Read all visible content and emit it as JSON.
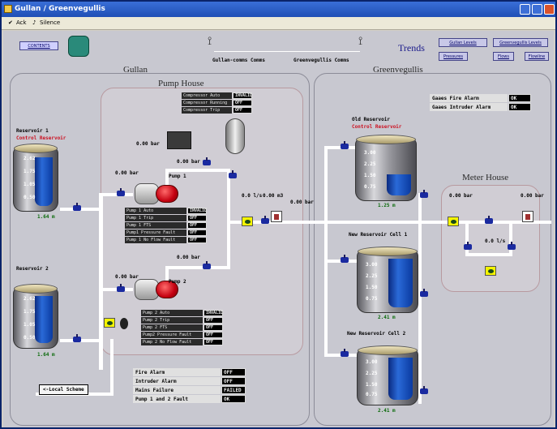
{
  "window": {
    "title": "Gullan / Greenvegullis"
  },
  "menu": {
    "item1": "Ack",
    "item2": "Silence"
  },
  "toolbar": {
    "contents_label": "CONTENTS"
  },
  "comms": {
    "label1": "Gullan-comms Comms",
    "label2": "Greenvegullis Comms"
  },
  "trends": {
    "label": "Trends",
    "buttons": [
      "Gullan Levels",
      "Greenvegullis Levels",
      "Pressures",
      "Flows",
      "Flowline"
    ]
  },
  "areas": {
    "gullan": "Gullan",
    "pump_house": "Pump House",
    "greenvegullis": "Greenvegullis",
    "meter_house": "Meter House"
  },
  "compressor": {
    "rows": [
      {
        "k": "Compressor Auto",
        "v": "INVALID"
      },
      {
        "k": "Compressor Running",
        "v": "OFF"
      },
      {
        "k": "Compressor Trip",
        "v": "OFF"
      }
    ]
  },
  "gv_alarms": {
    "rows": [
      {
        "k": "Gaaes Fire Alarm",
        "v": "OK"
      },
      {
        "k": "Gaaes Intruder Alarm",
        "v": "OK"
      }
    ]
  },
  "reservoirs": {
    "r1": {
      "label": "Reservoir 1",
      "sub": "Control Reservoir",
      "level": "1.64 m",
      "scale": [
        "2.62",
        "1.75",
        "1.05",
        "0.50"
      ]
    },
    "r2": {
      "label": "Reservoir 2",
      "level": "1.64 m",
      "scale": [
        "2.62",
        "1.75",
        "1.05",
        "0.50"
      ]
    },
    "old": {
      "label": "Old Reservoir",
      "sub": "Control Reservoir",
      "level": "1.25 m",
      "scale": [
        "3.00",
        "2.25",
        "1.50",
        "0.75"
      ]
    },
    "new1": {
      "label": "New Reservoir Cell 1",
      "level": "2.41 m",
      "scale": [
        "3.00",
        "2.25",
        "1.50",
        "0.75"
      ]
    },
    "new2": {
      "label": "New Reservoir Cell 2",
      "level": "2.41 m",
      "scale": [
        "3.00",
        "2.25",
        "1.50",
        "0.75"
      ]
    }
  },
  "pump1": {
    "label": "Pump 1",
    "rows": [
      {
        "k": "Pump 1 Auto",
        "v": "INVALID"
      },
      {
        "k": "Pump 1 Trip",
        "v": "OFF"
      },
      {
        "k": "Pump 1 FTS",
        "v": "OFF"
      },
      {
        "k": "Pump1 Pressure Fault",
        "v": "OFF"
      },
      {
        "k": "Pump 1 No Flow Fault",
        "v": "OFF"
      }
    ]
  },
  "pump2": {
    "label": "Pump 2",
    "rows": [
      {
        "k": "Pump 2 Auto",
        "v": "INVALID"
      },
      {
        "k": "Pump 2 Trip",
        "v": "OFF"
      },
      {
        "k": "Pump 2 FTS",
        "v": "OFF"
      },
      {
        "k": "Pump2 Pressure Fault",
        "v": "OFF"
      },
      {
        "k": "Pump 2 No Flow Fault",
        "v": "OFF"
      }
    ]
  },
  "readings": {
    "p1_top": "0.00 bar",
    "p1_in": "0.00 bar",
    "p2_top": "0.00 bar",
    "p2_in": "0.00 bar",
    "comp": "0.00 bar",
    "flow": "0.0 l/s",
    "flow2": "0.00 m3",
    "line": "0.00 bar",
    "mh_in": "0.00 bar",
    "mh_out": "0.00 bar",
    "mh_flow": "0.0 l/s"
  },
  "site_alarms": {
    "rows": [
      {
        "k": "Fire Alarm",
        "v": "OFF"
      },
      {
        "k": "Intruder Alarm",
        "v": "OFF"
      },
      {
        "k": "Mains Failure",
        "v": "FAILED"
      },
      {
        "k": "Pump 1 and 2 Fault",
        "v": "OK"
      }
    ]
  },
  "local_btn": "<-Local Scheme"
}
